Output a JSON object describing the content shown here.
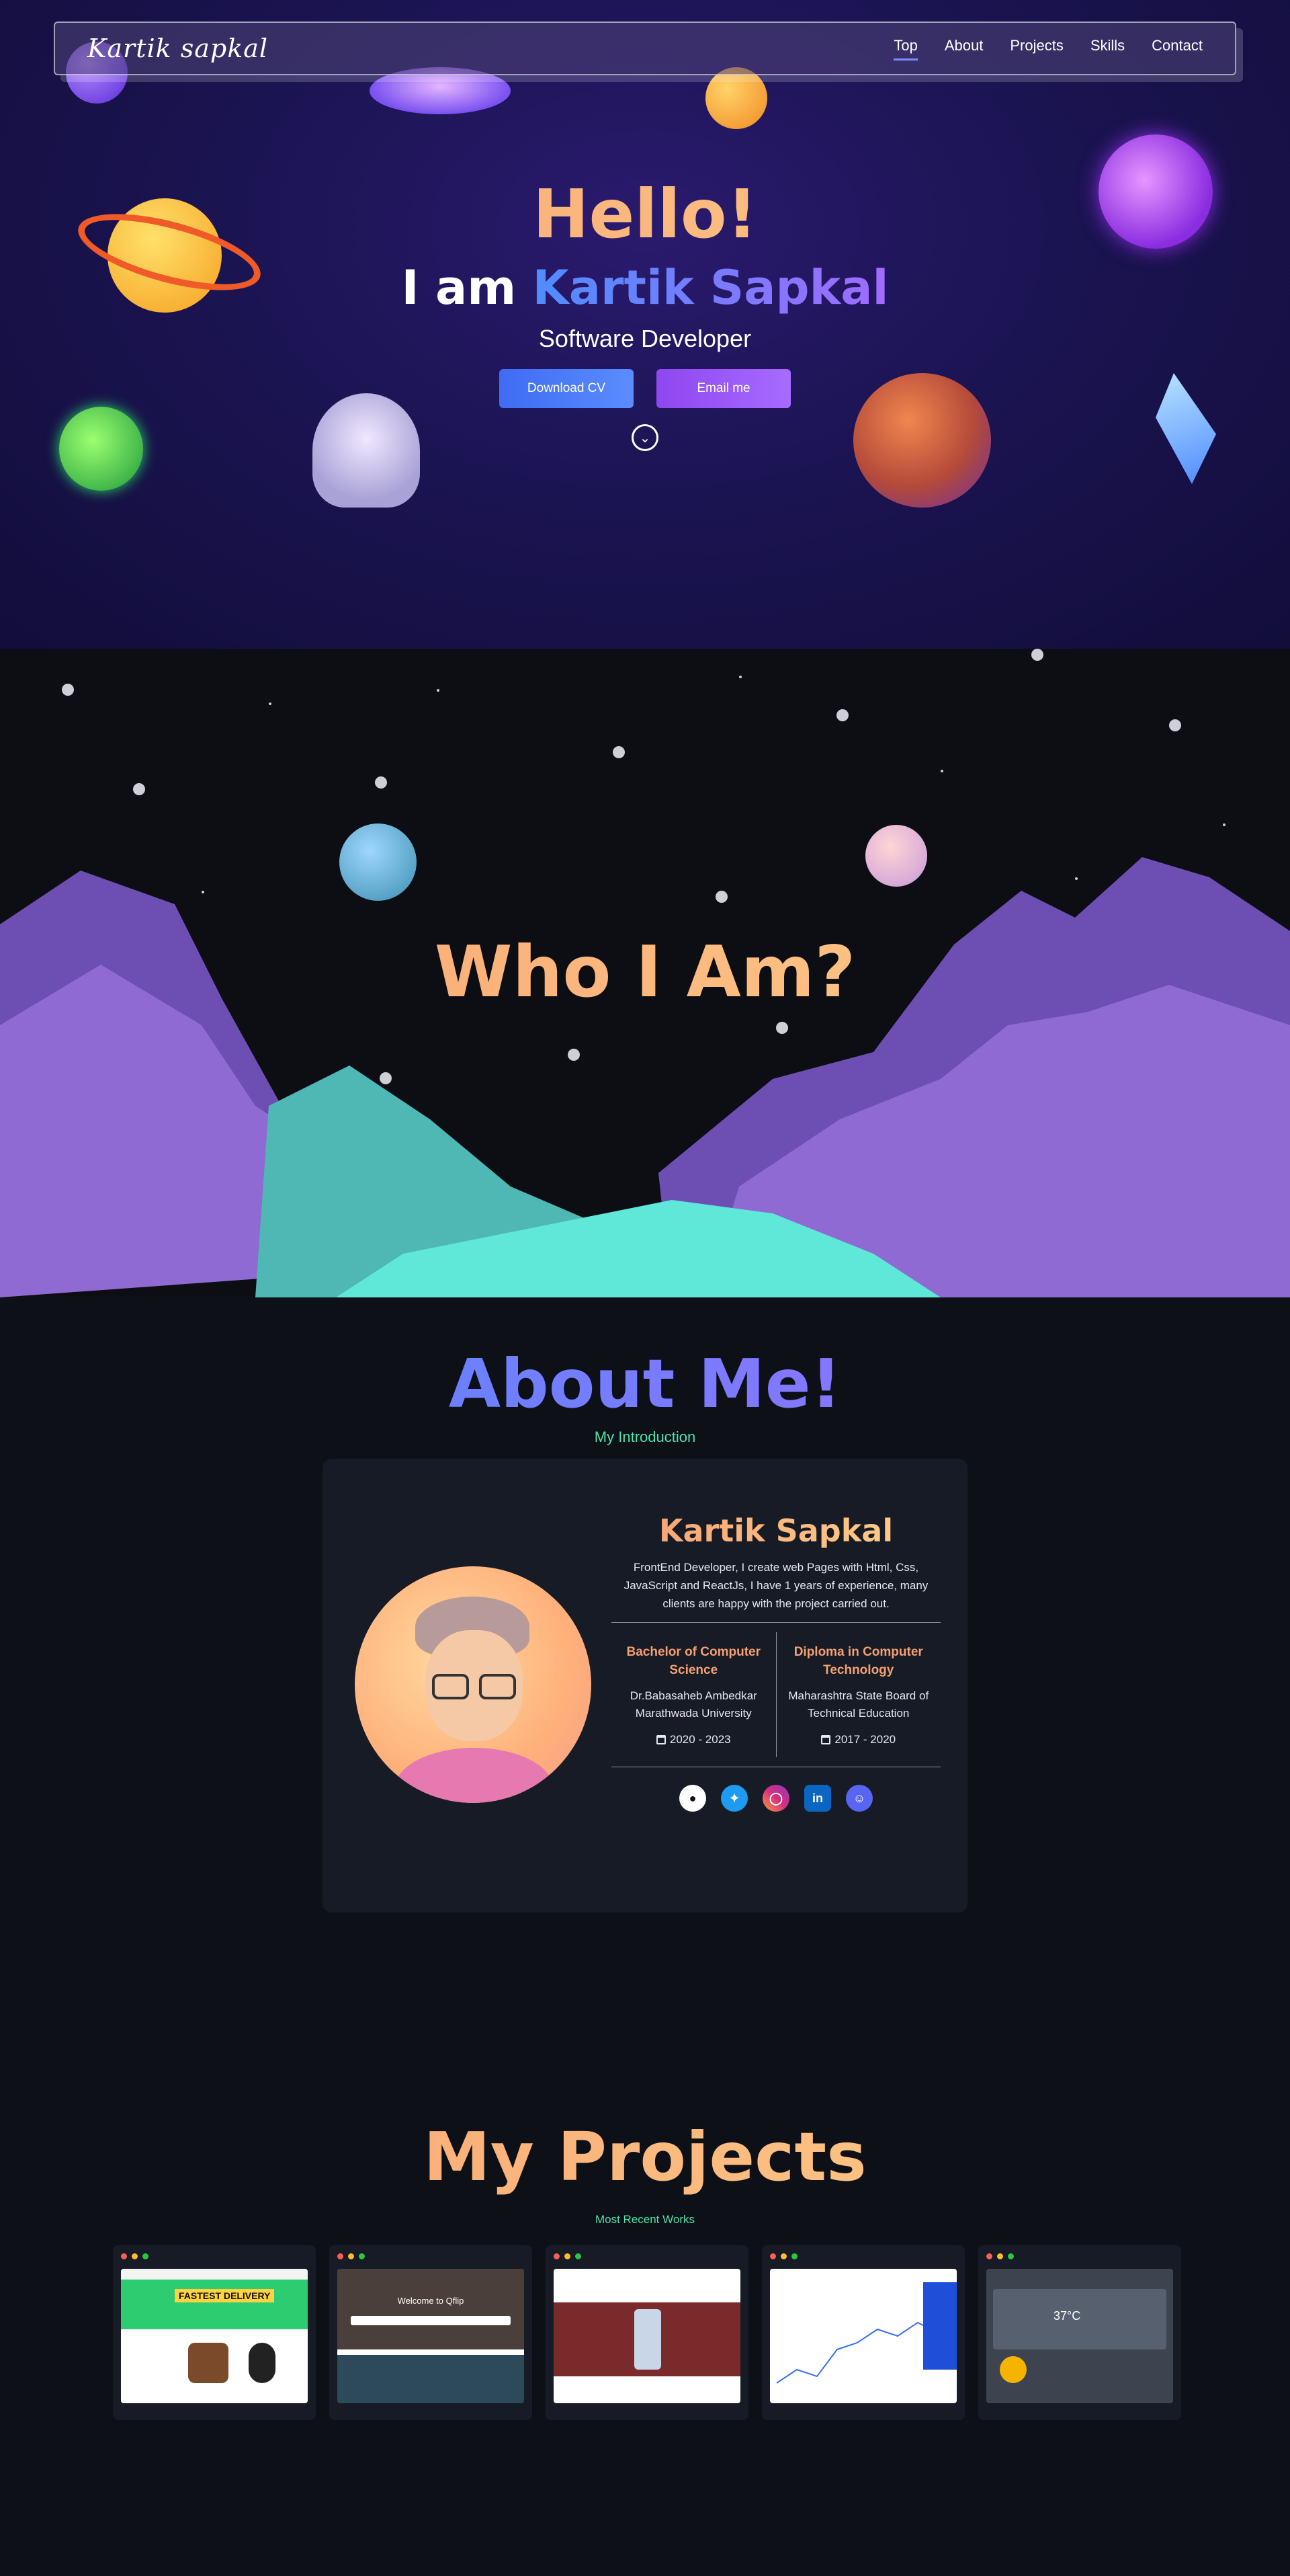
{
  "nav": {
    "logo": "Kartik sapkal",
    "links": [
      "Top",
      "About",
      "Projects",
      "Skills",
      "Contact"
    ]
  },
  "hero": {
    "hello": "Hello!",
    "iam_prefix": "I am ",
    "name": "Kartik Sapkal",
    "role": "Software Developer",
    "download_cv": "Download CV",
    "email_me": "Email me"
  },
  "who": {
    "title": "Who I Am?"
  },
  "about": {
    "title": "About Me!",
    "subtitle": "My Introduction",
    "name": "Kartik Sapkal",
    "description": "FrontEnd Developer, I create web Pages with Html, Css, JavaScript and ReactJs, I have 1 years of experience, many clients are happy with the project carried out.",
    "education": [
      {
        "title": "Bachelor of Computer Science",
        "institution": "Dr.Babasaheb Ambedkar Marathwada University",
        "years": "2020 - 2023"
      },
      {
        "title": "Diploma in Computer Technology",
        "institution": "Maharashtra State Board of Technical Education",
        "years": "2017 - 2020"
      }
    ],
    "socials": [
      "github-icon",
      "twitter-icon",
      "instagram-icon",
      "linkedin-icon",
      "discord-icon"
    ]
  },
  "projects": {
    "title": "My Projects",
    "subtitle": "Most Recent Works",
    "items": [
      {
        "overlay": "FASTEST DELIVERY"
      },
      {
        "overlay": "Welcome to Qflip"
      },
      {
        "overlay": ""
      },
      {
        "overlay": ""
      },
      {
        "overlay": "37°C"
      }
    ]
  },
  "colors": {
    "accent_orange": "#f7a072",
    "accent_blue": "#4f8cff",
    "accent_purple": "#a06bff",
    "accent_green": "#4fe3a8"
  }
}
